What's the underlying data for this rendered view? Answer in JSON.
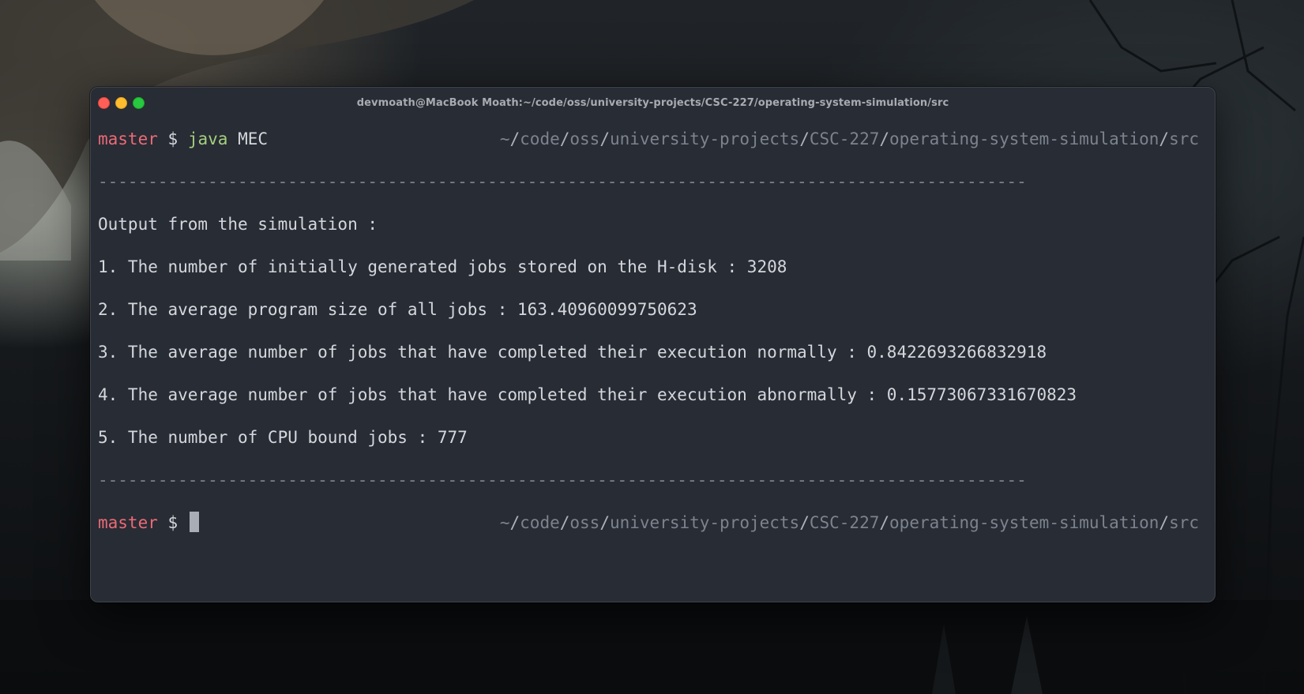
{
  "window": {
    "title": "devmoath@MacBook Moath:~/code/oss/university-projects/CSC-227/operating-system-simulation/src"
  },
  "prompt": {
    "branch": "master",
    "sign": "$",
    "path_segments": [
      "~",
      "code",
      "oss",
      "university-projects",
      "CSC-227",
      "operating-system-simulation",
      "src"
    ]
  },
  "command": {
    "program": "java",
    "argument": "MEC"
  },
  "divider": "---------------------------------------------------------------------------------------------",
  "output": {
    "heading": "Output from the simulation :",
    "lines": [
      "1. The number of initially generated jobs stored on the H-disk : 3208",
      "2. The average program size of all jobs : 163.40960099750623",
      "3. The average number of jobs that have completed their execution normally : 0.8422693266832918",
      "4. The average number of jobs that have completed their execution abnormally : 0.15773067331670823",
      "5. The number of CPU bound jobs : 777"
    ]
  },
  "colors": {
    "terminal_bg": "#282c34",
    "branch": "#ec6a77",
    "command": "#a5cf7f",
    "text": "#d4d7dd",
    "path": "#7d838d"
  }
}
